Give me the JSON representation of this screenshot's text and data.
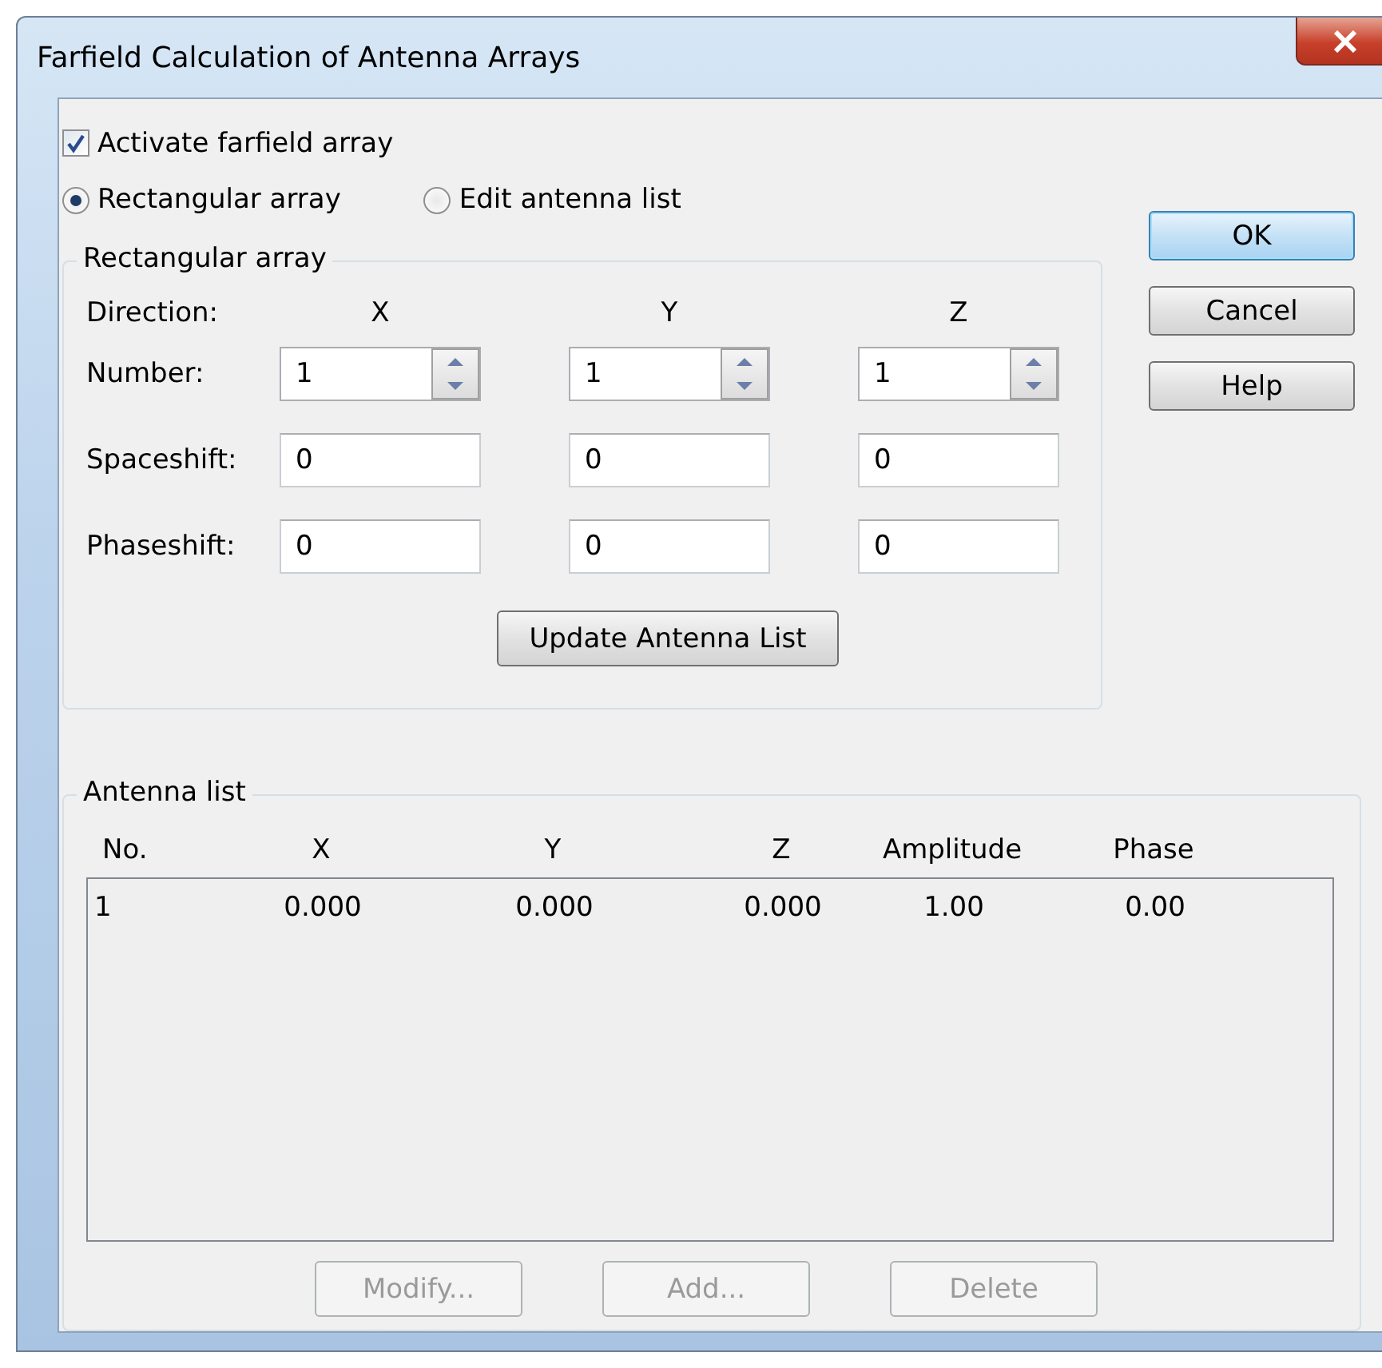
{
  "window": {
    "title": "Farfield Calculation of Antenna Arrays"
  },
  "activate": {
    "label": "Activate farfield array",
    "checked": true
  },
  "mode": [
    {
      "label": "Rectangular array",
      "selected": true
    },
    {
      "label": "Edit antenna list",
      "selected": false
    }
  ],
  "buttons": [
    {
      "label": "OK",
      "default": true
    },
    {
      "label": "Cancel",
      "default": false
    },
    {
      "label": "Help",
      "default": false
    }
  ],
  "rectangular_array": {
    "title": "Rectangular array",
    "direction_label": "Direction:",
    "columns": [
      "X",
      "Y",
      "Z"
    ],
    "rows": [
      {
        "label": "Number:",
        "kind": "spin",
        "values": [
          "1",
          "1",
          "1"
        ]
      },
      {
        "label": "Spaceshift:",
        "kind": "text",
        "values": [
          "0",
          "0",
          "0"
        ]
      },
      {
        "label": "Phaseshift:",
        "kind": "text",
        "values": [
          "0",
          "0",
          "0"
        ]
      }
    ],
    "update_button": "Update Antenna List"
  },
  "antenna_list": {
    "title": "Antenna list",
    "columns": [
      "No.",
      "X",
      "Y",
      "Z",
      "Amplitude",
      "Phase"
    ],
    "rows": [
      [
        "1",
        "0.000",
        "0.000",
        "0.000",
        "1.00",
        "0.00"
      ]
    ],
    "buttons": [
      {
        "label": "Modify...",
        "disabled": true
      },
      {
        "label": "Add...",
        "disabled": true
      },
      {
        "label": "Delete",
        "disabled": true
      }
    ]
  }
}
